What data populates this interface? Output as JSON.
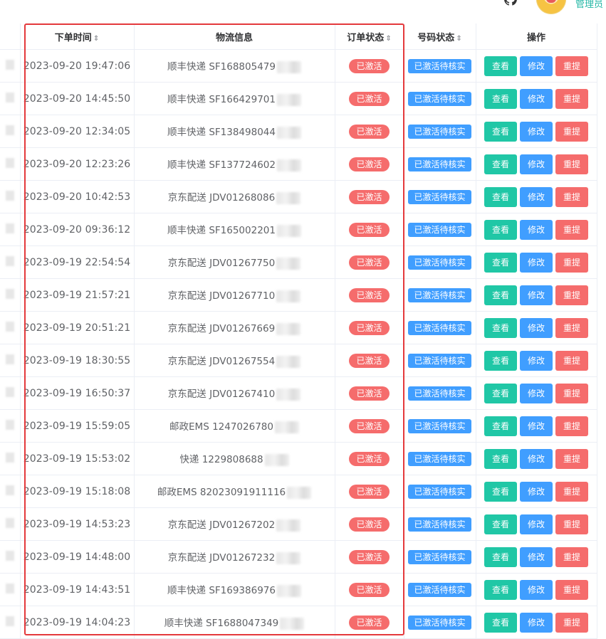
{
  "header": {
    "admin_label": "管理员",
    "col_time": "下单时间",
    "col_logistics": "物流信息",
    "col_order_status": "订单状态",
    "col_number_status": "号码状态",
    "col_actions": "操作",
    "sort_icon": "⇕"
  },
  "buttons": {
    "view": "查看",
    "edit": "修改",
    "resubmit": "重提"
  },
  "highlight_color": "#e4393c",
  "rows": [
    {
      "time": "2023-09-20 19:47:06",
      "logistics": "顺丰快递 SF168805479",
      "order_status": "已激活",
      "number_status": "已激活待核实"
    },
    {
      "time": "2023-09-20 14:45:50",
      "logistics": "顺丰快递 SF166429701",
      "order_status": "已激活",
      "number_status": "已激活待核实"
    },
    {
      "time": "2023-09-20 12:34:05",
      "logistics": "顺丰快递 SF138498044",
      "order_status": "已激活",
      "number_status": "已激活待核实"
    },
    {
      "time": "2023-09-20 12:23:26",
      "logistics": "顺丰快递 SF137724602",
      "order_status": "已激活",
      "number_status": "已激活待核实"
    },
    {
      "time": "2023-09-20 10:42:53",
      "logistics": "京东配送 JDV01268086",
      "order_status": "已激活",
      "number_status": "已激活待核实"
    },
    {
      "time": "2023-09-20 09:36:12",
      "logistics": "顺丰快递 SF165002201",
      "order_status": "已激活",
      "number_status": "已激活待核实"
    },
    {
      "time": "2023-09-19 22:54:54",
      "logistics": "京东配送 JDV01267750",
      "order_status": "已激活",
      "number_status": "已激活待核实"
    },
    {
      "time": "2023-09-19 21:57:21",
      "logistics": "京东配送 JDV01267710",
      "order_status": "已激活",
      "number_status": "已激活待核实"
    },
    {
      "time": "2023-09-19 20:51:21",
      "logistics": "京东配送 JDV01267669",
      "order_status": "已激活",
      "number_status": "已激活待核实"
    },
    {
      "time": "2023-09-19 18:30:55",
      "logistics": "京东配送 JDV01267554",
      "order_status": "已激活",
      "number_status": "已激活待核实"
    },
    {
      "time": "2023-09-19 16:50:37",
      "logistics": "京东配送 JDV01267410",
      "order_status": "已激活",
      "number_status": "已激活待核实"
    },
    {
      "time": "2023-09-19 15:59:05",
      "logistics": "邮政EMS 1247026780",
      "order_status": "已激活",
      "number_status": "已激活待核实"
    },
    {
      "time": "2023-09-19 15:53:02",
      "logistics": "快递 1229808688",
      "order_status": "已激活",
      "number_status": "已激活待核实"
    },
    {
      "time": "2023-09-19 15:18:08",
      "logistics": "邮政EMS 82023091911116",
      "order_status": "已激活",
      "number_status": "已激活待核实"
    },
    {
      "time": "2023-09-19 14:53:23",
      "logistics": "京东配送 JDV01267202",
      "order_status": "已激活",
      "number_status": "已激活待核实"
    },
    {
      "time": "2023-09-19 14:48:00",
      "logistics": "京东配送 JDV01267232",
      "order_status": "已激活",
      "number_status": "已激活待核实"
    },
    {
      "time": "2023-09-19 14:43:51",
      "logistics": "顺丰快递 SF169386976",
      "order_status": "已激活",
      "number_status": "已激活待核实"
    },
    {
      "time": "2023-09-19 14:04:23",
      "logistics": "顺丰快递 SF1688047349",
      "order_status": "已激活",
      "number_status": "已激活待核实"
    }
  ]
}
